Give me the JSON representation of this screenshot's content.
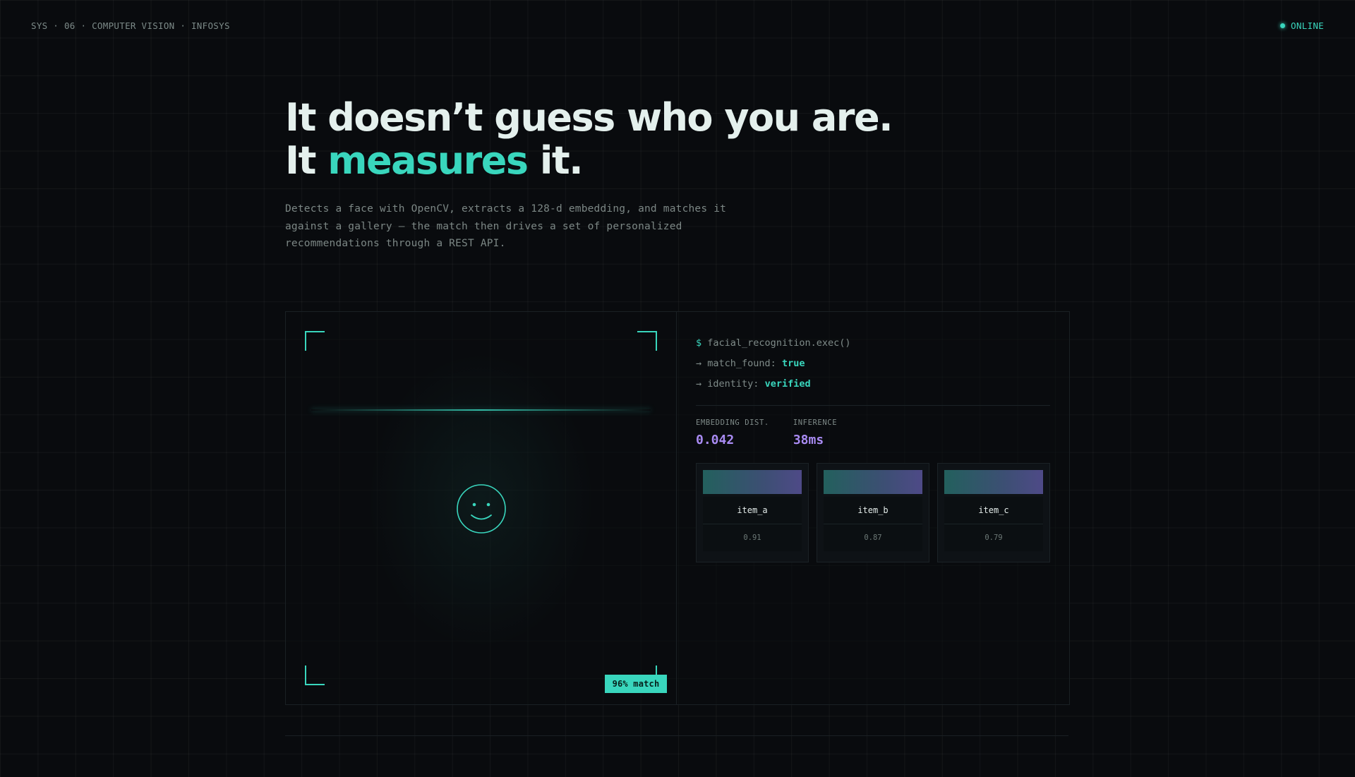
{
  "topbar": {
    "crumbs": [
      "SYS",
      "06",
      "COMPUTER VISION",
      "INFOSYS"
    ],
    "separator": " · ",
    "status": "ONLINE"
  },
  "hero": {
    "line1": "It doesn’t guess who you are.",
    "line2_prefix": "It ",
    "line2_accent": "measures",
    "line2_suffix": " it.",
    "subtext": "Detects a face with OpenCV, extracts a 128-d embedding, and matches it against a gallery — the match then drives a set of personalized recommendations through a REST API."
  },
  "camera": {
    "face_icon": "smiley-face-icon",
    "match_badge": "96% match"
  },
  "console": {
    "command_prompt": "$",
    "command": "facial_recognition.exec()",
    "arrow": "→",
    "match_found_key": "match_found:",
    "match_found_value": "true",
    "identity_key": "identity:",
    "identity_value": "verified",
    "metrics": [
      {
        "label": "EMBEDDING DIST.",
        "value": "0.042"
      },
      {
        "label": "INFERENCE",
        "value": "38ms"
      }
    ],
    "recommendations": [
      {
        "name": "item_a",
        "score": "0.91"
      },
      {
        "name": "item_b",
        "score": "0.87"
      },
      {
        "name": "item_c",
        "score": "0.79"
      }
    ]
  },
  "colors": {
    "accent": "#39d6bd",
    "metric": "#a98bf3",
    "background": "#090b0e"
  }
}
